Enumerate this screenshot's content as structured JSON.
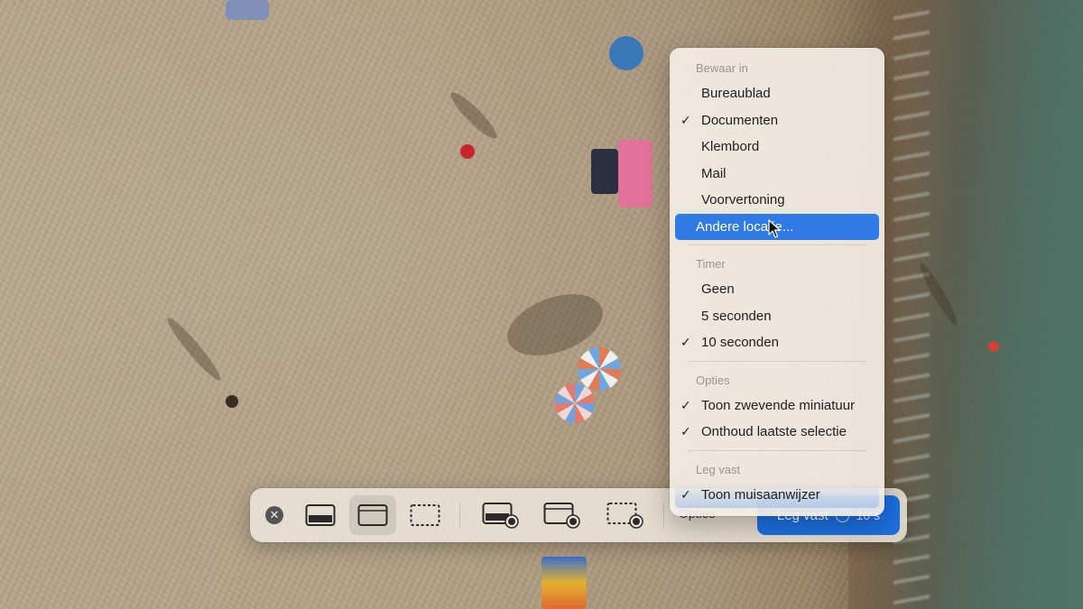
{
  "options_menu": {
    "sections": [
      {
        "header": "Bewaar in",
        "items": [
          {
            "label": "Bureaublad",
            "checked": false
          },
          {
            "label": "Documenten",
            "checked": true
          },
          {
            "label": "Klembord",
            "checked": false
          },
          {
            "label": "Mail",
            "checked": false
          },
          {
            "label": "Voorvertoning",
            "checked": false
          },
          {
            "label": "Andere locatie...",
            "checked": false,
            "highlighted": true
          }
        ]
      },
      {
        "header": "Timer",
        "items": [
          {
            "label": "Geen",
            "checked": false
          },
          {
            "label": "5 seconden",
            "checked": false
          },
          {
            "label": "10 seconden",
            "checked": true
          }
        ]
      },
      {
        "header": "Opties",
        "items": [
          {
            "label": "Toon zwevende miniatuur",
            "checked": true
          },
          {
            "label": "Onthoud laatste selectie",
            "checked": true
          }
        ]
      },
      {
        "header": "Leg vast",
        "items": [
          {
            "label": "Toon muisaanwijzer",
            "checked": true
          }
        ]
      }
    ],
    "check_glyph": "✓"
  },
  "toolbar": {
    "close_icon": "close-icon",
    "close_glyph": "✕",
    "capture_tools": [
      {
        "icon": "capture-entire-screen-icon",
        "selected": false
      },
      {
        "icon": "capture-selected-window-icon",
        "selected": true
      },
      {
        "icon": "capture-selected-portion-icon",
        "selected": false
      }
    ],
    "record_tools": [
      {
        "icon": "record-entire-screen-icon",
        "selected": false
      },
      {
        "icon": "record-window-icon",
        "selected": false
      },
      {
        "icon": "record-selected-portion-icon",
        "selected": false
      }
    ],
    "options_label": "Opties",
    "capture_label": "Leg vast",
    "capture_timer": "10 s"
  },
  "colors": {
    "accent": "#2f7ae5",
    "capture_button": "#1d6fe0"
  }
}
